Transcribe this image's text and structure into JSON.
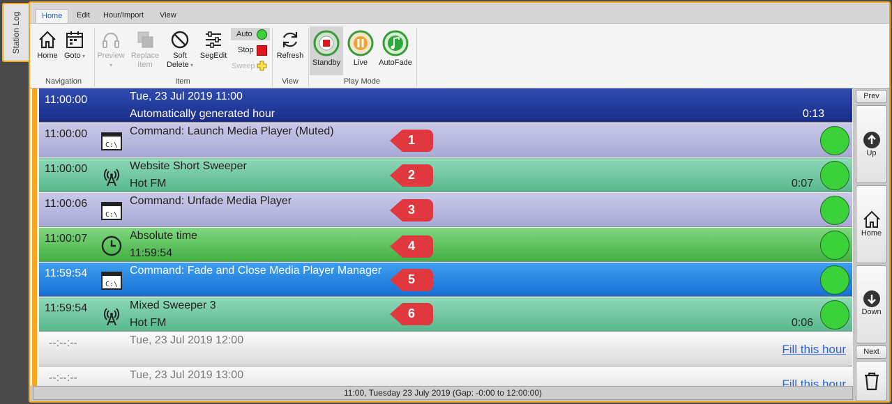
{
  "side_tab": "Station Log",
  "tabs": [
    "Home",
    "Edit",
    "Hour/Import",
    "View"
  ],
  "active_tab": "Home",
  "ribbon": {
    "navigation": {
      "label": "Navigation",
      "home": "Home",
      "goto": "Goto"
    },
    "item": {
      "label": "Item",
      "preview": "Preview",
      "replace": "Replace",
      "replace2": "Item",
      "soft": "Soft",
      "soft2": "Delete",
      "segedit": "SegEdit",
      "auto": "Auto",
      "stop": "Stop",
      "sweep": "Sweep"
    },
    "view": {
      "label": "View",
      "refresh": "Refresh"
    },
    "playmode": {
      "label": "Play Mode",
      "standby": "Standby",
      "live": "Live",
      "autofade": "AutoFade"
    }
  },
  "log": {
    "hour": {
      "time": "11:00:00",
      "title": "Tue, 23 Jul 2019 11:00",
      "subtitle": "Automatically generated hour",
      "duration": "0:13"
    },
    "rows": [
      {
        "time": "11:00:00",
        "icon": "command-icon",
        "title": "Command: Launch Media Player (Muted)",
        "subtitle": "",
        "duration": "",
        "badge": "1"
      },
      {
        "time": "11:00:00",
        "icon": "broadcast-icon",
        "title": "Website Short Sweeper",
        "subtitle": "Hot FM",
        "duration": "0:07",
        "badge": "2"
      },
      {
        "time": "11:00:06",
        "icon": "command-icon",
        "title": "Command: Unfade Media Player",
        "subtitle": "",
        "duration": "",
        "badge": "3"
      },
      {
        "time": "11:00:07",
        "icon": "clock-icon",
        "title": "Absolute time",
        "subtitle": "11:59:54",
        "duration": "",
        "badge": "4"
      },
      {
        "time": "11:59:54",
        "icon": "command-icon",
        "title": "Command: Fade and Close Media Player Manager",
        "subtitle": "",
        "duration": "",
        "badge": "5"
      },
      {
        "time": "11:59:54",
        "icon": "broadcast-icon",
        "title": "Mixed Sweeper 3",
        "subtitle": "Hot FM",
        "duration": "0:06",
        "badge": "6"
      }
    ],
    "empty_hours": [
      {
        "time": "--:--:--",
        "title": "Tue, 23 Jul 2019 12:00",
        "link": "Fill this hour"
      },
      {
        "time": "--:--:--",
        "title": "Tue, 23 Jul 2019 13:00",
        "link": "Fill this hour"
      }
    ]
  },
  "right_nav": {
    "prev": "Prev",
    "up": "Up",
    "home": "Home",
    "down": "Down",
    "next": "Next"
  },
  "status": "11:00, Tuesday 23 July 2019 (Gap: -0:00 to 12:00:00)",
  "colors": {
    "accent": "#f5a623",
    "hour_row": "#1f3396",
    "command_row": "#b8b8de",
    "sweeper_row": "#6cc4a0",
    "time_row": "#58c058",
    "selected_row": "#1e7ce0",
    "badge": "#e0383e",
    "play_dot": "#3bd13b"
  }
}
